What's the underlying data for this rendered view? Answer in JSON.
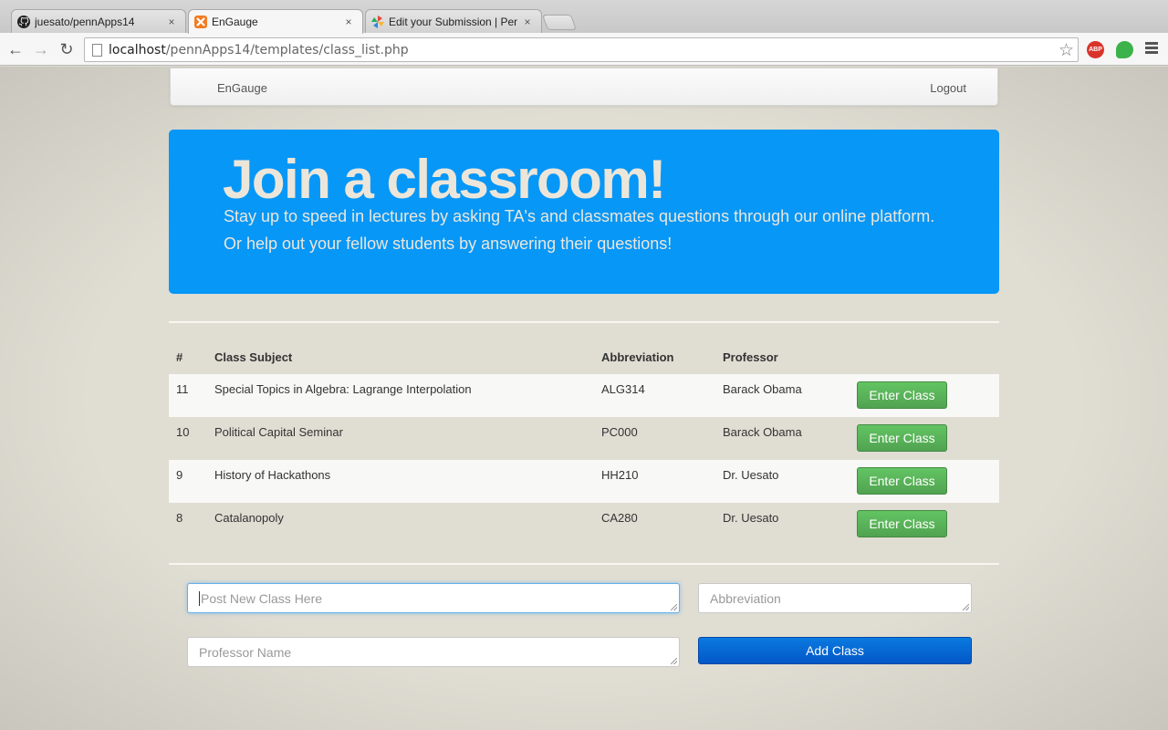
{
  "browser": {
    "tabs": [
      {
        "title": "juesato/pennApps14",
        "icon": "github-icon",
        "close": "×"
      },
      {
        "title": "EnGauge",
        "icon": "xampp-icon",
        "close": "×"
      },
      {
        "title": "Edit your Submission | Pen",
        "icon": "pinwheel-icon",
        "close": "×"
      }
    ],
    "url_host": "localhost",
    "url_path": "/pennApps14/templates/class_list.php",
    "abp_label": "ABP"
  },
  "navbar": {
    "brand": "EnGauge",
    "logout": "Logout"
  },
  "hero": {
    "title": "Join a classroom!",
    "text": "Stay up to speed in lectures by asking TA's and classmates questions through our online platform. Or help out your fellow students by answering their questions!"
  },
  "table": {
    "headers": [
      "#",
      "Class Subject",
      "Abbreviation",
      "Professor"
    ],
    "rows": [
      {
        "num": "11",
        "subject": "Special Topics in Algebra: Lagrange Interpolation",
        "abbr": "ALG314",
        "prof": "Barack Obama",
        "action": "Enter Class"
      },
      {
        "num": "10",
        "subject": "Political Capital Seminar",
        "abbr": "PC000",
        "prof": "Barack Obama",
        "action": "Enter Class"
      },
      {
        "num": "9",
        "subject": "History of Hackathons",
        "abbr": "HH210",
        "prof": "Dr. Uesato",
        "action": "Enter Class"
      },
      {
        "num": "8",
        "subject": "Catalanopoly",
        "abbr": "CA280",
        "prof": "Dr. Uesato",
        "action": "Enter Class"
      }
    ]
  },
  "form": {
    "class_placeholder": "Post New Class Here",
    "abbr_placeholder": "Abbreviation",
    "prof_placeholder": "Professor Name",
    "submit": "Add Class"
  },
  "colors": {
    "hero_bg": "#0797f7",
    "enter_button": "#5bb75b",
    "add_button": "#0866d6"
  }
}
